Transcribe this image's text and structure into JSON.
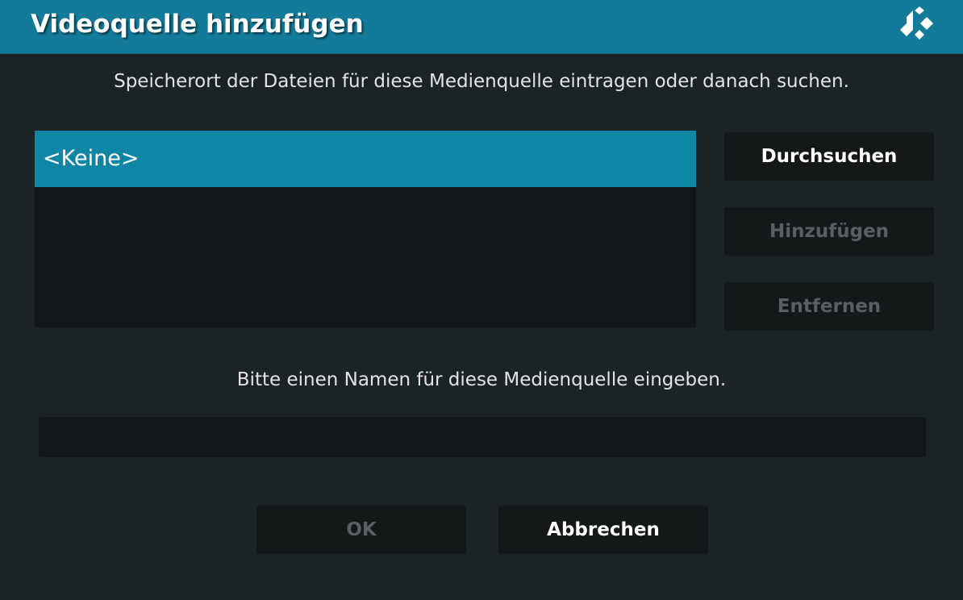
{
  "dialog": {
    "title": "Videoquelle hinzufügen",
    "logo_icon": "kodi-logo-icon"
  },
  "source": {
    "instruction": "Speicherort der Dateien für diese Medienquelle eintragen oder danach suchen.",
    "paths": [
      "<Keine>"
    ],
    "selected_index": 0
  },
  "side_buttons": {
    "browse": "Durchsuchen",
    "add": "Hinzufügen",
    "remove": "Entfernen"
  },
  "name": {
    "instruction": "Bitte einen Namen für diese Medienquelle eingeben.",
    "value": ""
  },
  "footer": {
    "ok": "OK",
    "cancel": "Abbrechen"
  },
  "colors": {
    "header": "#137a9a",
    "selection": "#0f86a6",
    "background": "#1c2327",
    "button": "#141819",
    "disabled_text": "#5a5f62"
  }
}
